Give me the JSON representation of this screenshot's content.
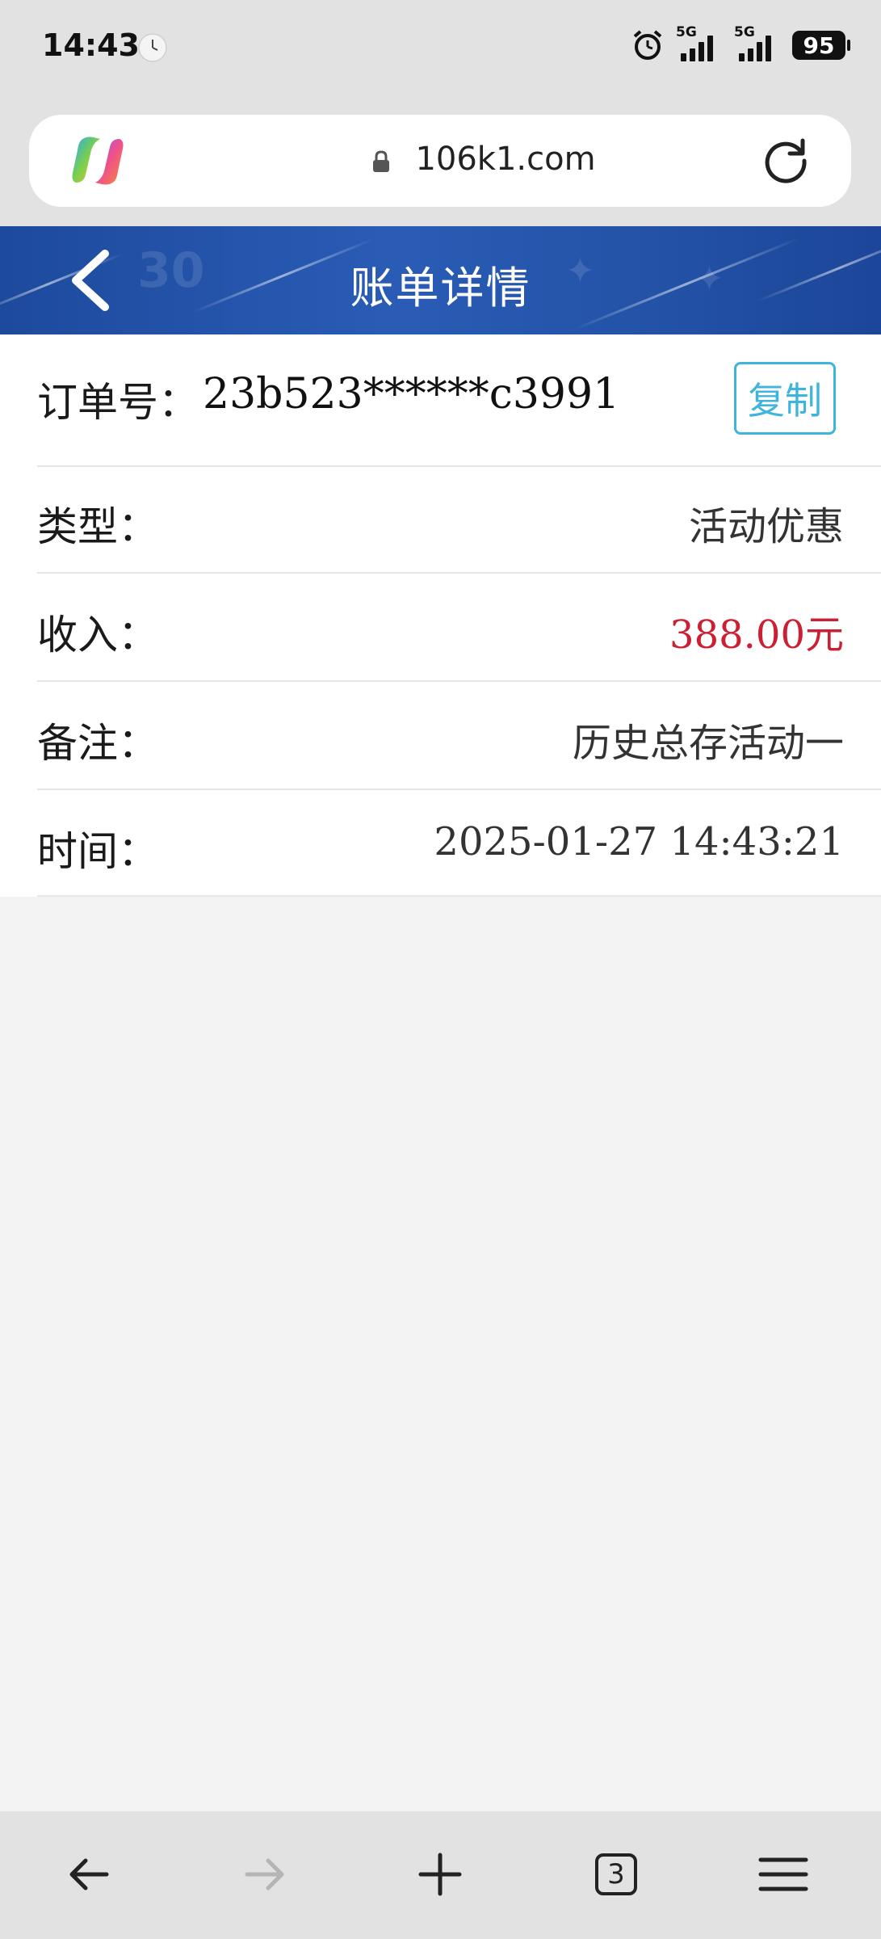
{
  "status_bar": {
    "time": "14:43",
    "network_1": "5G",
    "network_2": "5G",
    "battery": "95"
  },
  "browser": {
    "url": "106k1.com",
    "tab_count": "3"
  },
  "header": {
    "title": "账单详情"
  },
  "order": {
    "label": "订单号：",
    "value": "23b523******c3991",
    "copy_label": "复制"
  },
  "details": [
    {
      "label": "类型：",
      "value": "活动优惠"
    },
    {
      "label": "收入：",
      "value": "388.00元"
    },
    {
      "label": "备注：",
      "value": "历史总存活动一"
    },
    {
      "label": "时间：",
      "value": "2025-01-27 14:43:21"
    }
  ],
  "colors": {
    "header_blue": "#2454a8",
    "income_red": "#cc1f33",
    "copy_cyan": "#3fb4dc",
    "page_bg": "#f3f3f4"
  }
}
